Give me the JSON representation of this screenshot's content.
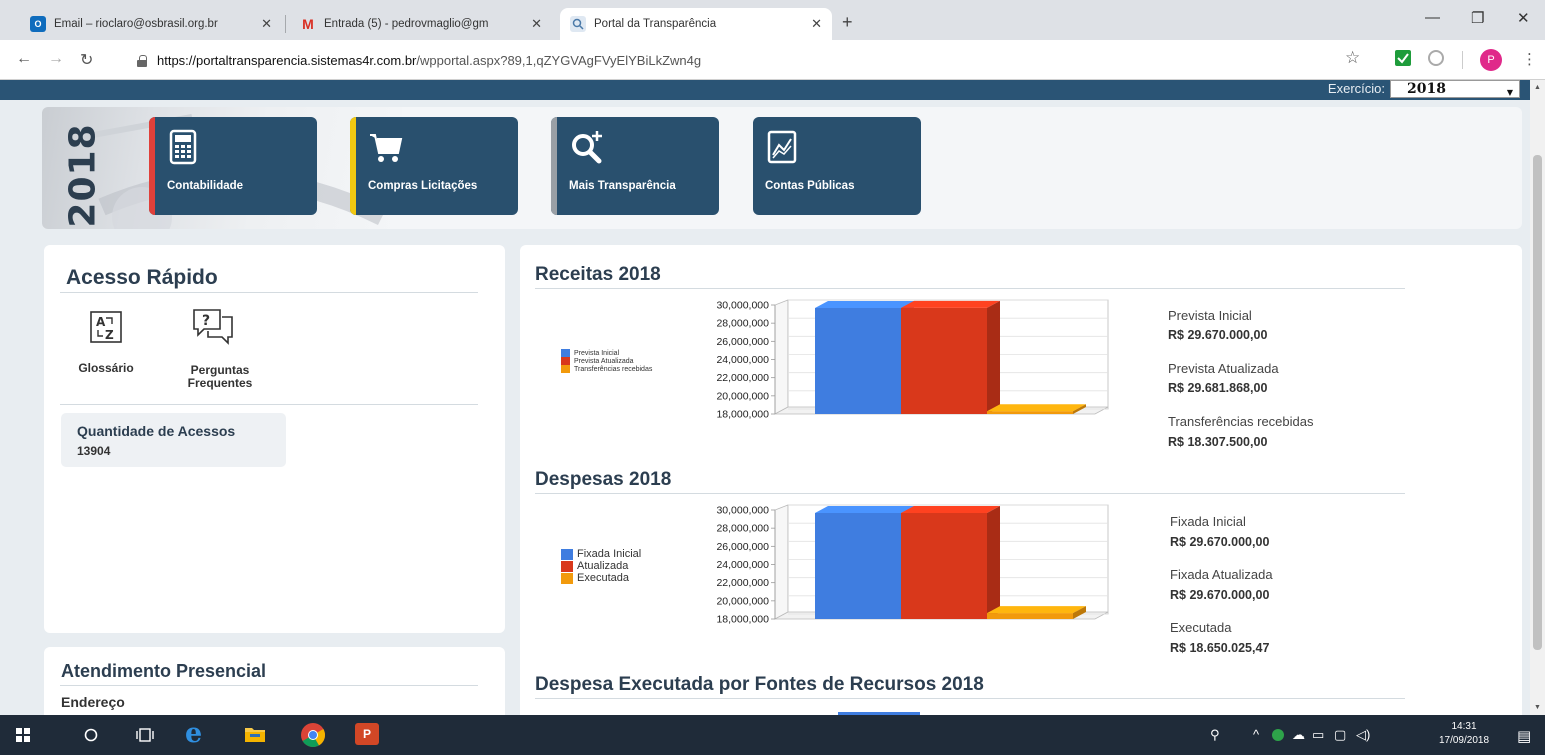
{
  "browser": {
    "tabs": [
      {
        "title": "Email – rioclaro@osbrasil.org.br",
        "favicon": "outlook-icon",
        "color": "#0f6cbd"
      },
      {
        "title": "Entrada (5) - pedrovmaglio@gm",
        "favicon": "gmail-icon",
        "color": "#d93025"
      },
      {
        "title": "Portal da Transparência",
        "favicon": "portal-icon",
        "color": "#4a79a8"
      }
    ],
    "new_tab": "+",
    "url_host": "https://portaltransparencia.sistemas4r.com.br",
    "url_path": "/wpportal.aspx?89,1,qZYGVAgFVyElYBiLkZwn4g",
    "profile_initial": "P"
  },
  "header": {
    "exercicio_label": "Exercício:",
    "year": "2018"
  },
  "banner": {
    "year_vertical": "2018",
    "tiles": [
      {
        "label": "Contabilidade",
        "icon": "calculator-icon",
        "stripe": "#e0403a"
      },
      {
        "label": "Compras Licitações",
        "icon": "shopping-cart-icon",
        "stripe": "#f2c811"
      },
      {
        "label": "Mais Transparência",
        "icon": "search-plus-icon",
        "stripe": "#9aa0a6"
      },
      {
        "label": "Contas Públicas",
        "icon": "chart-document-icon",
        "stripe": ""
      }
    ]
  },
  "sidebar": {
    "quick_access_title": "Acesso Rápido",
    "glossario_label": "Glossário",
    "perguntas_label_1": "Perguntas",
    "perguntas_label_2": "Frequentes",
    "acessos_title": "Quantidade de Acessos",
    "acessos_value": "13904",
    "atendimento_title": "Atendimento Presencial",
    "endereco_label": "Endereço"
  },
  "main": {
    "receitas_title": "Receitas 2018",
    "despesas_title": "Despesas 2018",
    "fontes_title": "Despesa Executada por Fontes de Recursos 2018",
    "receitas_stats": [
      {
        "label": "Prevista Inicial",
        "value": "R$ 29.670.000,00"
      },
      {
        "label": "Prevista Atualizada",
        "value": "R$ 29.681.868,00"
      },
      {
        "label": "Transferências recebidas",
        "value": "R$ 18.307.500,00"
      }
    ],
    "despesas_stats": [
      {
        "label": "Fixada Inicial",
        "value": "R$ 29.670.000,00"
      },
      {
        "label": "Fixada Atualizada",
        "value": "R$ 29.670.000,00"
      },
      {
        "label": "Executada",
        "value": "R$ 18.650.025,47"
      }
    ]
  },
  "chart_data": [
    {
      "type": "bar",
      "categories": [
        "Prevista Inicial",
        "Prevista Atualizada",
        "Transferências recebidas"
      ],
      "values": [
        29670000,
        29681868,
        18307500
      ],
      "colors": [
        "#3f7de0",
        "#d9381b",
        "#f29a0c"
      ],
      "ylim": [
        18000000,
        30000000
      ],
      "yticks": [
        "18,000,000",
        "20,000,000",
        "22,000,000",
        "24,000,000",
        "26,000,000",
        "28,000,000",
        "30,000,000"
      ],
      "legend": "left"
    },
    {
      "type": "bar",
      "categories": [
        "Fixada Inicial",
        "Atualizada",
        "Executada"
      ],
      "values": [
        29670000,
        29670000,
        18650025.47
      ],
      "colors": [
        "#3f7de0",
        "#d9381b",
        "#f29a0c"
      ],
      "ylim": [
        18000000,
        30000000
      ],
      "yticks": [
        "18,000,000",
        "20,000,000",
        "22,000,000",
        "24,000,000",
        "26,000,000",
        "28,000,000",
        "30,000,000"
      ],
      "legend": "left"
    }
  ],
  "taskbar": {
    "time": "14:31",
    "date": "17/09/2018"
  }
}
